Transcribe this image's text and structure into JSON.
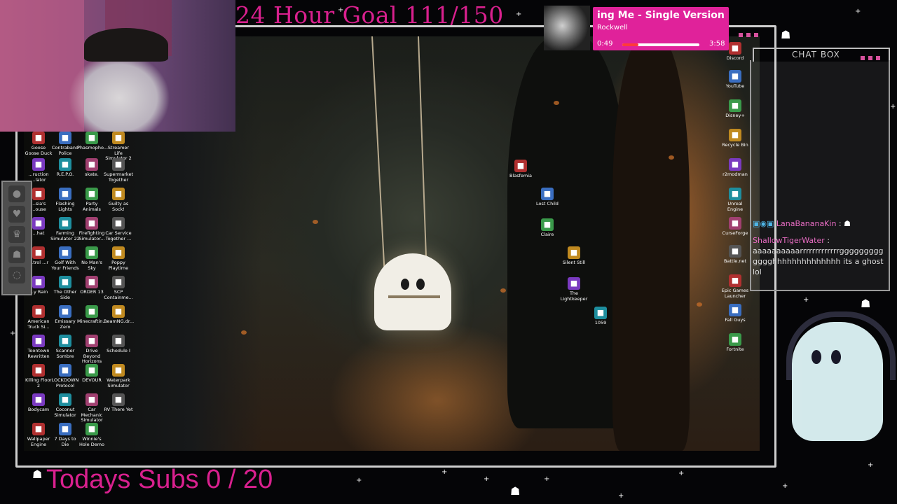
{
  "overlay": {
    "goal_text": "24 Hour Goal 111/150",
    "subs_text": "Todays Subs 0 / 20"
  },
  "now_playing": {
    "title": "ing Me - Single Version",
    "artist": "Rockwell",
    "elapsed": "0:49",
    "duration": "3:58",
    "progress": 0.21
  },
  "chat": {
    "header": "CHAT BOX",
    "messages": [
      {
        "user": "LanaBananaKin",
        "text": ""
      },
      {
        "user": "ShallowTigerWater",
        "text": "aaaaaaaaaarrrrrrrrrrrrrggggggggggggghhhhhhhhhhhhhh its a ghost lol"
      }
    ]
  },
  "desktop": {
    "left_icons": [
      {
        "label": "Goose Goose Duck",
        "icon": "game-icon"
      },
      {
        "label": "Contraband Police",
        "icon": "game-icon"
      },
      {
        "label": "Phasmopho...",
        "icon": "game-icon"
      },
      {
        "label": "Streamer Life Simulator 2",
        "icon": "game-icon"
      },
      {
        "label": "...ruction ...lator",
        "icon": "game-icon"
      },
      {
        "label": "R.E.P.O.",
        "icon": "game-icon"
      },
      {
        "label": "skate.",
        "icon": "game-icon"
      },
      {
        "label": "Supermarket Together",
        "icon": "game-icon"
      },
      {
        "label": "...sia's ...ouse",
        "icon": "game-icon"
      },
      {
        "label": "Flashing Lights",
        "icon": "game-icon"
      },
      {
        "label": "Party Animals",
        "icon": "game-icon"
      },
      {
        "label": "Guilty as Sock!",
        "icon": "game-icon"
      },
      {
        "label": "...hat",
        "icon": "game-icon"
      },
      {
        "label": "Farming Simulator 22",
        "icon": "game-icon"
      },
      {
        "label": "Firefighting Simulator...",
        "icon": "game-icon"
      },
      {
        "label": "Car Service Together ...",
        "icon": "game-icon"
      },
      {
        "label": "...trol ...r",
        "icon": "game-icon"
      },
      {
        "label": "Golf With Your Friends",
        "icon": "game-icon"
      },
      {
        "label": "No Man's Sky",
        "icon": "game-icon"
      },
      {
        "label": "Poppy Playtime",
        "icon": "game-icon"
      },
      {
        "label": "...y Rain",
        "icon": "game-icon"
      },
      {
        "label": "The Other Side",
        "icon": "game-icon"
      },
      {
        "label": "ORDER 13",
        "icon": "game-icon"
      },
      {
        "label": "SCP Containme...",
        "icon": "game-icon"
      },
      {
        "label": "American Truck Si...",
        "icon": "game-icon"
      },
      {
        "label": "Emissary Zero",
        "icon": "game-icon"
      },
      {
        "label": "Minecraftin...",
        "icon": "game-icon"
      },
      {
        "label": "BeamNG.dr...",
        "icon": "game-icon"
      },
      {
        "label": "Toontown Rewritten",
        "icon": "game-icon"
      },
      {
        "label": "Scanner Sombre",
        "icon": "game-icon"
      },
      {
        "label": "Drive Beyond Horizons",
        "icon": "game-icon"
      },
      {
        "label": "Schedule I",
        "icon": "game-icon"
      },
      {
        "label": "Killing Floor 2",
        "icon": "game-icon"
      },
      {
        "label": "LOCKDOWN Protocol",
        "icon": "game-icon"
      },
      {
        "label": "DEVOUR",
        "icon": "game-icon"
      },
      {
        "label": "Waterpark Simulator",
        "icon": "game-icon"
      },
      {
        "label": "Bodycam",
        "icon": "game-icon"
      },
      {
        "label": "Coconut Simulator",
        "icon": "game-icon"
      },
      {
        "label": "Car Mechanic Simulator 2...",
        "icon": "game-icon"
      },
      {
        "label": "RV There Yet",
        "icon": "game-icon"
      },
      {
        "label": "Wallpaper Engine",
        "icon": "game-icon"
      },
      {
        "label": "7 Days to Die",
        "icon": "game-icon"
      },
      {
        "label": "Winnie's Hole Demo",
        "icon": "game-icon"
      }
    ],
    "mid_icons": [
      {
        "label": "Blasfemia"
      },
      {
        "label": "Lost Child"
      },
      {
        "label": "Claire"
      },
      {
        "label": "Silent Still"
      },
      {
        "label": "The Lightkeeper"
      },
      {
        "label": "1059"
      }
    ],
    "right_icons": [
      {
        "label": "Discord"
      },
      {
        "label": "YouTube"
      },
      {
        "label": "Disney+"
      },
      {
        "label": "Recycle Bin"
      },
      {
        "label": "r2modman"
      },
      {
        "label": "Unreal Engine"
      },
      {
        "label": "CurseForge"
      },
      {
        "label": "Battle.net"
      },
      {
        "label": "Epic Games Launcher"
      },
      {
        "label": "Fall Guys"
      },
      {
        "label": "Fortnite"
      }
    ]
  },
  "colors": {
    "accent_pink": "#d9208e",
    "np_pink": "#e0229a",
    "frame": "#cfcfcf"
  }
}
